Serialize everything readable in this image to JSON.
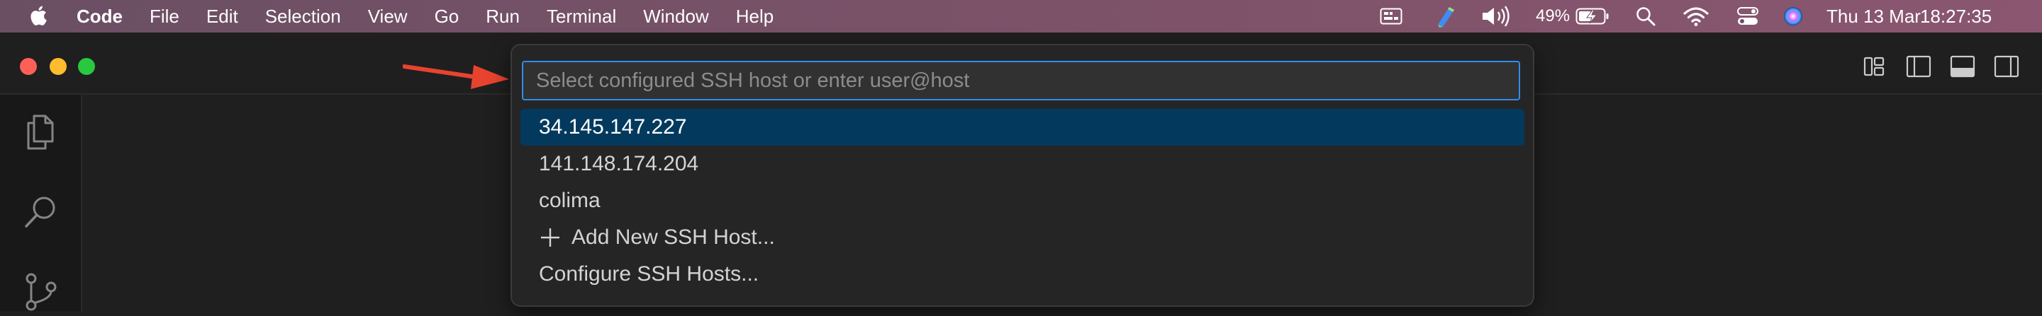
{
  "menubar": {
    "app_name": "Code",
    "menus": [
      "File",
      "Edit",
      "Selection",
      "View",
      "Go",
      "Run",
      "Terminal",
      "Window",
      "Help"
    ],
    "battery_percent": "49%",
    "date": "Thu 13 Mar",
    "time": "18:27:35"
  },
  "quick_pick": {
    "placeholder": "Select configured SSH host or enter user@host",
    "items": [
      {
        "label": "34.145.147.227",
        "selected": true
      },
      {
        "label": "141.148.174.204",
        "selected": false
      },
      {
        "label": "colima",
        "selected": false
      },
      {
        "label": "Add New SSH Host...",
        "selected": false,
        "icon": "plus-icon"
      },
      {
        "label": "Configure SSH Hosts...",
        "selected": false
      }
    ]
  },
  "colors": {
    "selection": "#04395e",
    "input_border": "#2f8ee8",
    "annotation_arrow": "#e8432f"
  }
}
